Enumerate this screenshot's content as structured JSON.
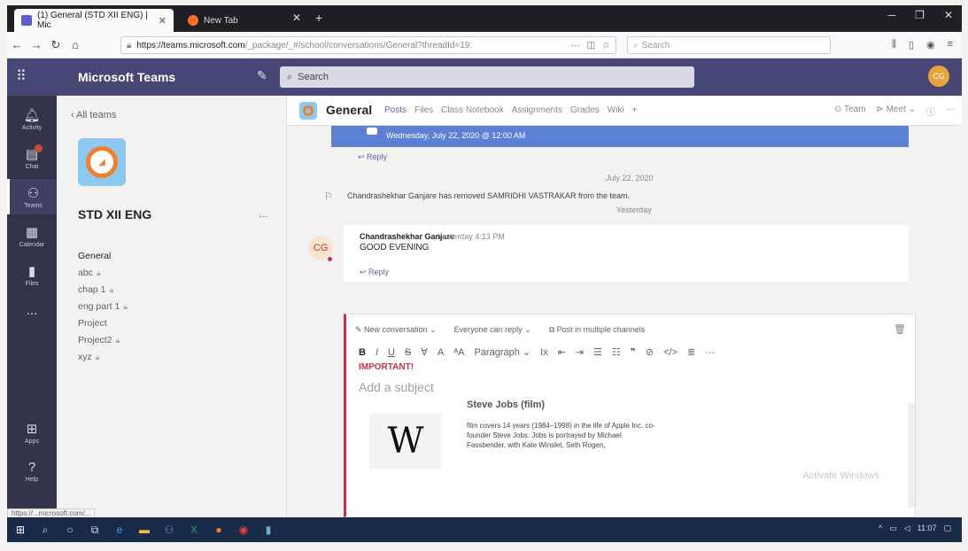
{
  "browser": {
    "active_tab_title": "(1) General (STD XII ENG) | Mic",
    "inactive_tab_title": "New Tab",
    "url_host": "https://teams.microsoft.com",
    "url_path": "/_package/_#/school/conversations/General?threadId=19:",
    "search_placeholder": "Search",
    "status_url": "https://...microsoft.com/..."
  },
  "teams": {
    "app_title": "Microsoft Teams",
    "search_placeholder": "Search",
    "me_initials": "CG"
  },
  "rail": [
    {
      "label": "Activity",
      "icon": "bell-icon"
    },
    {
      "label": "Chat",
      "icon": "chat-icon"
    },
    {
      "label": "Teams",
      "icon": "teams-icon"
    },
    {
      "label": "Calendar",
      "icon": "calendar-icon"
    },
    {
      "label": "Files",
      "icon": "files-icon"
    },
    {
      "label": "...",
      "icon": "more-icon"
    },
    {
      "label": "Apps",
      "icon": "apps-icon"
    },
    {
      "label": "Help",
      "icon": "help-icon"
    }
  ],
  "left_pane": {
    "back_link": "All teams",
    "team_name": "STD XII ENG",
    "more": "...",
    "channels": [
      {
        "name": "General",
        "locked": false
      },
      {
        "name": "abc",
        "locked": true
      },
      {
        "name": "chap 1",
        "locked": true
      },
      {
        "name": "eng part 1",
        "locked": true
      },
      {
        "name": "Project",
        "locked": false
      },
      {
        "name": "Project2",
        "locked": true
      },
      {
        "name": "xyz",
        "locked": true
      }
    ]
  },
  "channel_header": {
    "name": "General",
    "tabs": [
      "Posts",
      "Files",
      "Class Notebook",
      "Assignments",
      "Grades",
      "Wiki",
      "+"
    ],
    "team_btn": "Team",
    "meet_btn": "Meet"
  },
  "feed": {
    "event_time": "Wednesday, July 22, 2020 @ 12:00 AM",
    "reply_label": "Reply",
    "date_divider_1": "July 22, 2020",
    "system_message": "Chandrashekhar Ganjare has removed SAMRIDHI VASTRAKAR from the team.",
    "date_divider_2": "Yesterday",
    "message": {
      "initials": "CG",
      "author": "Chandrashekhar Ganjare",
      "time": "Yesterday 4:13 PM",
      "body": "GOOD EVENING"
    }
  },
  "composer": {
    "new_conversation": "New conversation",
    "reply_setting": "Everyone can reply",
    "post_multiple": "Post in multiple channels",
    "paragraph": "Paragraph",
    "important": "IMPORTANT!",
    "subject_placeholder": "Add a subject",
    "wiki_title": "Steve Jobs (film)",
    "wiki_logo": "W",
    "wiki_text": "film covers 14 years (1984–1998) in the life of Apple Inc. co-founder Steve Jobs. Jobs is portrayed by Michael Fassbender, with Kate Winslet, Seth Rogen,",
    "watermark": "Activate Windows"
  },
  "taskbar": {
    "time": "11:07"
  },
  "colors": {
    "teams_purple": "#464775",
    "rail": "#33344a",
    "accent": "#6264a7",
    "important_red": "#c4314b",
    "event_blue": "#5b80d4"
  }
}
